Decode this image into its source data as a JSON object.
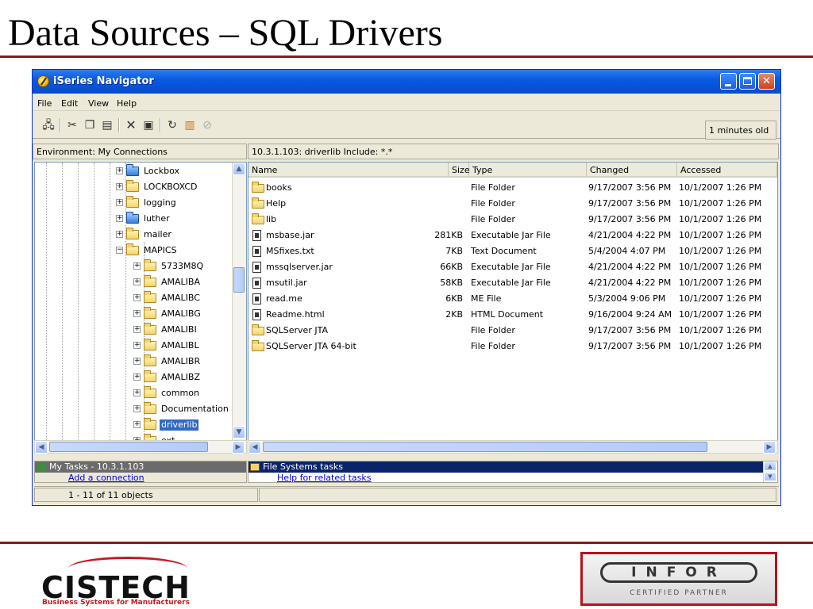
{
  "slide": {
    "title": "Data Sources – SQL Drivers"
  },
  "window": {
    "title": "iSeries Navigator",
    "controls": {
      "minimize": "_",
      "maximize": "□",
      "close": "✕"
    }
  },
  "menu": [
    "File",
    "Edit",
    "View",
    "Help"
  ],
  "toolbar": {
    "icons": [
      "connect-icon",
      "cut-icon",
      "copy-icon",
      "paste-icon",
      "delete-icon",
      "properties-icon",
      "refresh-icon",
      "columns-icon",
      "stop-icon"
    ],
    "age": "1 minutes old"
  },
  "left_pane": {
    "header": "Environment: My Connections"
  },
  "right_pane": {
    "header": "10.3.1.103:  driverlib     Include: *.*"
  },
  "tree": {
    "items": [
      {
        "label": "Lockbox",
        "icon": "special"
      },
      {
        "label": "LOCKBOXCD",
        "icon": "folder"
      },
      {
        "label": "logging",
        "icon": "folder"
      },
      {
        "label": "luther",
        "icon": "special"
      },
      {
        "label": "mailer",
        "icon": "folder"
      },
      {
        "label": "MAPICS",
        "icon": "folder",
        "expanded": true
      },
      {
        "label": "5733M8Q",
        "icon": "folder"
      },
      {
        "label": "AMALIBA",
        "icon": "folder"
      },
      {
        "label": "AMALIBC",
        "icon": "folder"
      },
      {
        "label": "AMALIBG",
        "icon": "folder"
      },
      {
        "label": "AMALIBI",
        "icon": "folder"
      },
      {
        "label": "AMALIBL",
        "icon": "folder"
      },
      {
        "label": "AMALIBR",
        "icon": "folder"
      },
      {
        "label": "AMALIBZ",
        "icon": "folder"
      },
      {
        "label": "common",
        "icon": "folder"
      },
      {
        "label": "Documentation",
        "icon": "folder"
      },
      {
        "label": "driverlib",
        "icon": "folder",
        "selected": true
      },
      {
        "label": "ext",
        "icon": "folder"
      }
    ]
  },
  "files": {
    "columns": [
      "Name",
      "Size",
      "Type",
      "Changed",
      "Accessed"
    ],
    "rows": [
      {
        "name": "books",
        "size": "",
        "type": "File Folder",
        "changed": "9/17/2007 3:56 PM",
        "accessed": "10/1/2007 1:26 PM",
        "icon": "folder"
      },
      {
        "name": "Help",
        "size": "",
        "type": "File Folder",
        "changed": "9/17/2007 3:56 PM",
        "accessed": "10/1/2007 1:26 PM",
        "icon": "folder"
      },
      {
        "name": "lib",
        "size": "",
        "type": "File Folder",
        "changed": "9/17/2007 3:56 PM",
        "accessed": "10/1/2007 1:26 PM",
        "icon": "folder"
      },
      {
        "name": "msbase.jar",
        "size": "281KB",
        "type": "Executable Jar File",
        "changed": "4/21/2004 4:22 PM",
        "accessed": "10/1/2007 1:26 PM",
        "icon": "file"
      },
      {
        "name": "MSfixes.txt",
        "size": "7KB",
        "type": "Text Document",
        "changed": "5/4/2004 4:07 PM",
        "accessed": "10/1/2007 1:26 PM",
        "icon": "file"
      },
      {
        "name": "mssqlserver.jar",
        "size": "66KB",
        "type": "Executable Jar File",
        "changed": "4/21/2004 4:22 PM",
        "accessed": "10/1/2007 1:26 PM",
        "icon": "file"
      },
      {
        "name": "msutil.jar",
        "size": "58KB",
        "type": "Executable Jar File",
        "changed": "4/21/2004 4:22 PM",
        "accessed": "10/1/2007 1:26 PM",
        "icon": "file"
      },
      {
        "name": "read.me",
        "size": "6KB",
        "type": "ME File",
        "changed": "5/3/2004 9:06 PM",
        "accessed": "10/1/2007 1:26 PM",
        "icon": "file"
      },
      {
        "name": "Readme.html",
        "size": "2KB",
        "type": "HTML Document",
        "changed": "9/16/2004 9:24 AM",
        "accessed": "10/1/2007 1:26 PM",
        "icon": "file"
      },
      {
        "name": "SQLServer JTA",
        "size": "",
        "type": "File Folder",
        "changed": "9/17/2007 3:56 PM",
        "accessed": "10/1/2007 1:26 PM",
        "icon": "folder"
      },
      {
        "name": "SQLServer JTA 64-bit",
        "size": "",
        "type": "File Folder",
        "changed": "9/17/2007 3:56 PM",
        "accessed": "10/1/2007 1:26 PM",
        "icon": "folder"
      }
    ]
  },
  "tasks": {
    "left_header": "My Tasks - 10.3.1.103",
    "left_link": "Add a connection",
    "right_header": "File Systems tasks",
    "right_link": "Help for related tasks"
  },
  "status": {
    "count": "1 - 11 of 11 objects"
  },
  "logos": {
    "cistech": {
      "word": "CISTECH",
      "tagline": "Business Systems for Manufacturers",
      "accent": "#c01b22"
    },
    "infor": {
      "word": "INFOR",
      "subtitle": "CERTIFIED PARTNER",
      "border": "#b5131c"
    }
  },
  "colors": {
    "titlebar": "#0a5ae0",
    "selection": "#316ac5",
    "rule": "#8b1a1a"
  }
}
